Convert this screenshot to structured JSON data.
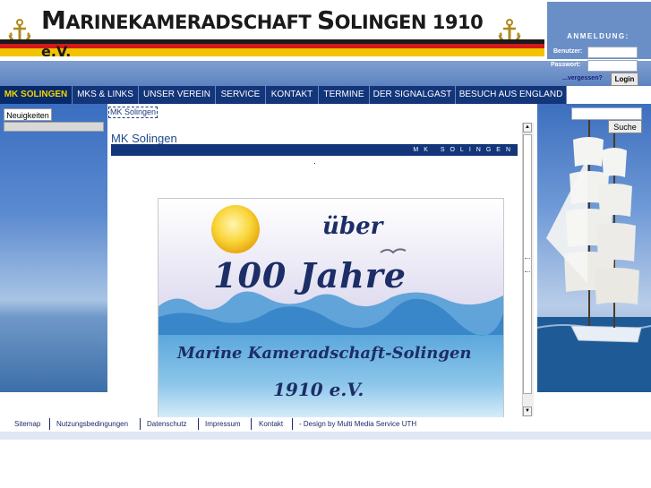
{
  "header": {
    "title_part1_big": "M",
    "title_part1": "ARINEKAMERADSCHAFT ",
    "title_part2_big": "S",
    "title_part2": "OLINGEN 1910",
    "title_line2": "e.V.",
    "anchor_icon": "anchor-icon",
    "flag_colors": [
      "#1a1a1a",
      "#d21a1a",
      "#f2c400"
    ]
  },
  "login": {
    "title": "ANMELDUNG:",
    "user_label": "Benutzer:",
    "user_value": "",
    "password_label": "Passwort:",
    "password_value": "",
    "forgot_link": "...vergessen?",
    "login_button": "Login"
  },
  "nav": {
    "items": [
      {
        "label": "MK SOLINGEN",
        "active": true
      },
      {
        "label": "MKS & LINKS",
        "active": false
      },
      {
        "label": "UNSER VEREIN",
        "active": false
      },
      {
        "label": "SERVICE",
        "active": false
      },
      {
        "label": "KONTAKT",
        "active": false
      },
      {
        "label": "TERMINE",
        "active": false
      },
      {
        "label": "DER SIGNALGAST",
        "active": false
      },
      {
        "label": "BESUCH AUS ENGLAND",
        "active": false
      }
    ]
  },
  "sidebar": {
    "news_tab": "Neuigkeiten"
  },
  "search": {
    "value": "",
    "button": "Suche"
  },
  "main": {
    "breadcrumb": "MK Solingen",
    "page_title": "MK Solingen",
    "section_bar": "MK SOLINGEN",
    "banner": {
      "line1": "über",
      "line2": "100 Jahre",
      "line3": "Marine Kameradschaft-Solingen",
      "line4": "1910 e.V."
    }
  },
  "footer": {
    "links": [
      "Sitemap",
      "Nutzungsbedingungen",
      "Datenschutz",
      "Impressum",
      "Kontakt"
    ],
    "credit": "- Design by Multi Media Service UTH"
  },
  "colors": {
    "nav_bg": "#13357a",
    "nav_active_text": "#f2d400",
    "accent_blue": "#1d4a8c"
  }
}
